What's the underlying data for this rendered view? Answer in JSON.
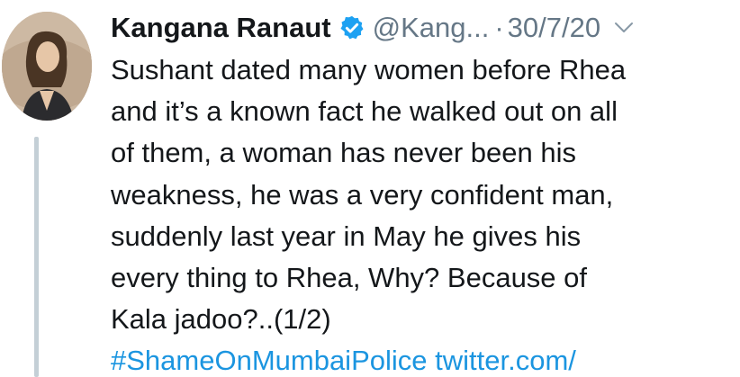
{
  "tweet": {
    "author_name": "Kangana Ranaut",
    "handle": "@Kang...",
    "separator": "·",
    "date": "30/7/20",
    "text": "Sushant dated many women before Rhea\nand it’s a known fact he walked out on all\nof them, a woman has never been his\nweakness, he was a very confident man,\nsuddenly last year in May he gives his\nevery thing to Rhea, Why? Because of\nKala jadoo?..(1/2)",
    "hashtag": "#ShameOnMumbaiPolice",
    "link": "twitter.com/"
  },
  "icons": {
    "verified": "verified-badge-icon",
    "more": "chevron-down-icon"
  },
  "colors": {
    "text": "#14171a",
    "secondary": "#657786",
    "link": "#1b95e0",
    "verified": "#1da1f2",
    "thread_line": "#c4cfd6"
  }
}
